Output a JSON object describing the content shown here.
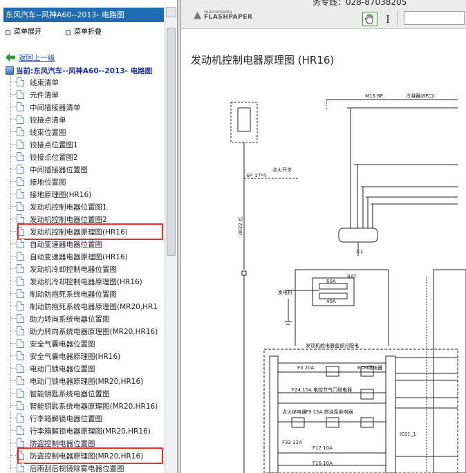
{
  "left_panel": {
    "title": "东风汽车--风神A60--2013- 电路图",
    "menu_expand": "菜单展开",
    "menu_collapse": "菜单折叠",
    "back": "返回上一级",
    "current": "当前:东风汽车--风神A60--2013- 电路图",
    "items": [
      {
        "label": "线束清单"
      },
      {
        "label": "元件清单"
      },
      {
        "label": "中间插接器清单"
      },
      {
        "label": "铰接点清单"
      },
      {
        "label": "线束位置图"
      },
      {
        "label": "铰接点位置图1"
      },
      {
        "label": "铰接点位置图2"
      },
      {
        "label": "中间插接器位置图"
      },
      {
        "label": "接地位置图"
      },
      {
        "label": "接地原理图(HR16)"
      },
      {
        "label": "发动机控制电器位置图1"
      },
      {
        "label": "发动机控制电器位置图2"
      },
      {
        "label": "发动机控制电器原理图(HR16)",
        "highlighted": true
      },
      {
        "label": "自动变速器电器位置图"
      },
      {
        "label": "自动变速器电器原理图(HR16)"
      },
      {
        "label": "发动机冷却控制电器位置图"
      },
      {
        "label": "发动机冷却控制电器原理图(HR16)"
      },
      {
        "label": "制动防抱死系统电器位置图"
      },
      {
        "label": "制动防抱死系统电器原理图(MR20,HR1"
      },
      {
        "label": "助力转向系统电器位置图"
      },
      {
        "label": "助力转向系统电器原理图(MR20,HR16)"
      },
      {
        "label": "安全气囊电器位置图"
      },
      {
        "label": "安全气囊电器原理图(HR16)"
      },
      {
        "label": "电动门锁电器位置图"
      },
      {
        "label": "电动门锁电器原理图(MR20,HR16)"
      },
      {
        "label": "智能钥匙系统电器位置图"
      },
      {
        "label": "智能钥匙系统电器原理图(MR20,HR16)"
      },
      {
        "label": "行李箱解锁电器位置图"
      },
      {
        "label": "行李箱解锁电器原理图(MR20,HR16)"
      },
      {
        "label": "防盗控制电器位置图"
      },
      {
        "label": "防盗控制电器原理图(MR20,HR16)",
        "highlighted": true
      },
      {
        "label": "后雨刮后视镜除雾电器位置图"
      }
    ]
  },
  "viewer": {
    "phone": "务专线：028-87038205",
    "logo_small": "macromedia",
    "logo_big": "FLASHPAPER",
    "hand_icon": "hand-tool-icon",
    "text_icon": "text-select-icon",
    "doc_title": "发动机控制电器原理图 (HR16)",
    "diagram_labels": {
      "m16": "M16 8P",
      "washer": "冷凝器(8P口)",
      "ign": "点火开关",
      "sp": "SP_17*4",
      "wire1": "0022 红",
      "bat": "BAT",
      "fuse60": "60A",
      "fuse40": "40A",
      "gen": "发电机",
      "ecm_box": "发动机舱电器盒部分配电",
      "fuse_f3": "F3 20A",
      "ecm_relay": "ECM继电器",
      "f24": "F24 15A 电控节气门继电器",
      "f9": "F9 15A 燃油泵继电器",
      "ign_relay": "点火继电器",
      "f32": "F32 12A",
      "f17": "F17 10A",
      "f16": "F16 10A",
      "c1": "C1",
      "ic01": "IC01_1"
    }
  },
  "colors": {
    "title_bg": "#1f6cb0",
    "highlight": "#e53030",
    "link": "#1a40b0"
  }
}
